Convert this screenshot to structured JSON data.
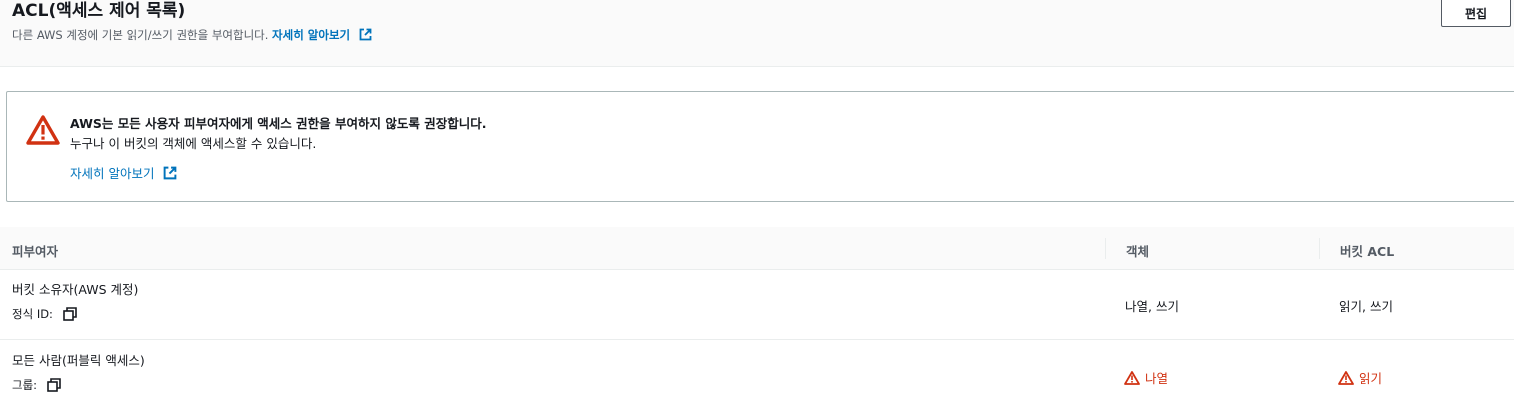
{
  "header": {
    "title": "ACL(액세스 제어 목록)",
    "subtitle": "다른 AWS 계정에 기본 읽기/쓰기 권한을 부여합니다.",
    "learn_more": "자세히 알아보기",
    "edit_label": "편집"
  },
  "alert": {
    "title": "AWS는 모든 사용자 피부여자에게 액세스 권한을 부여하지 않도록 권장합니다.",
    "description": "누구나 이 버킷의 객체에 액세스할 수 있습니다.",
    "learn_more": "자세히 알아보기"
  },
  "table": {
    "columns": [
      "피부여자",
      "객체",
      "버킷 ACL"
    ],
    "rows": [
      {
        "grantee": "버킷 소유자(AWS 계정)",
        "detail_label": "정식 ID:",
        "objects": "나열, 쓰기",
        "bucket_acl": "읽기, 쓰기"
      },
      {
        "grantee": "모든 사람(퍼블릭 액세스)",
        "detail_label": "그룹:",
        "objects": "나열",
        "bucket_acl": "읽기"
      }
    ]
  },
  "colors": {
    "link": "#0073bb",
    "warning": "#d13212",
    "border": "#eaeded"
  }
}
